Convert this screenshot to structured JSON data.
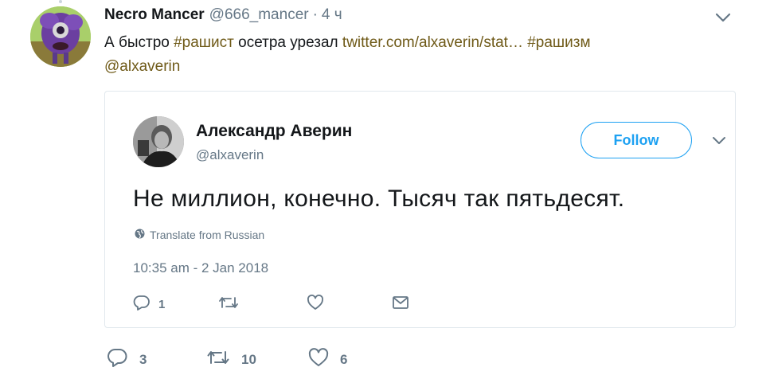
{
  "tweet": {
    "author_name": "Necro Mancer",
    "author_handle": "@666_mancer",
    "separator": "·",
    "time": "4 ч",
    "text": {
      "part1": "А быстро ",
      "hashtag1": "#рашист",
      "part2": " осетра урезал ",
      "url": "twitter.com/alxaverin/stat…",
      "part3": " ",
      "hashtag2": "#рашизм",
      "mention": "@alxaverin"
    },
    "stats": {
      "replies": "3",
      "retweets": "10",
      "likes": "6"
    }
  },
  "quoted": {
    "author_name": "Александр Аверин",
    "author_handle": "@alxaverin",
    "follow_label": "Follow",
    "text": "Не миллион, конечно. Тысяч так пятьдесят.",
    "translate_label": "Translate from Russian",
    "timestamp": "10:35 am - 2 Jan 2018",
    "stats": {
      "replies": "1"
    }
  },
  "colors": {
    "accent": "#1da1f2",
    "secondary_text": "#657786",
    "link_text": "#6f5a18",
    "border": "#e1e8ed"
  },
  "icons": [
    "chevron-down-icon",
    "reply-icon",
    "retweet-icon",
    "like-icon",
    "dm-icon",
    "globe-icon"
  ]
}
